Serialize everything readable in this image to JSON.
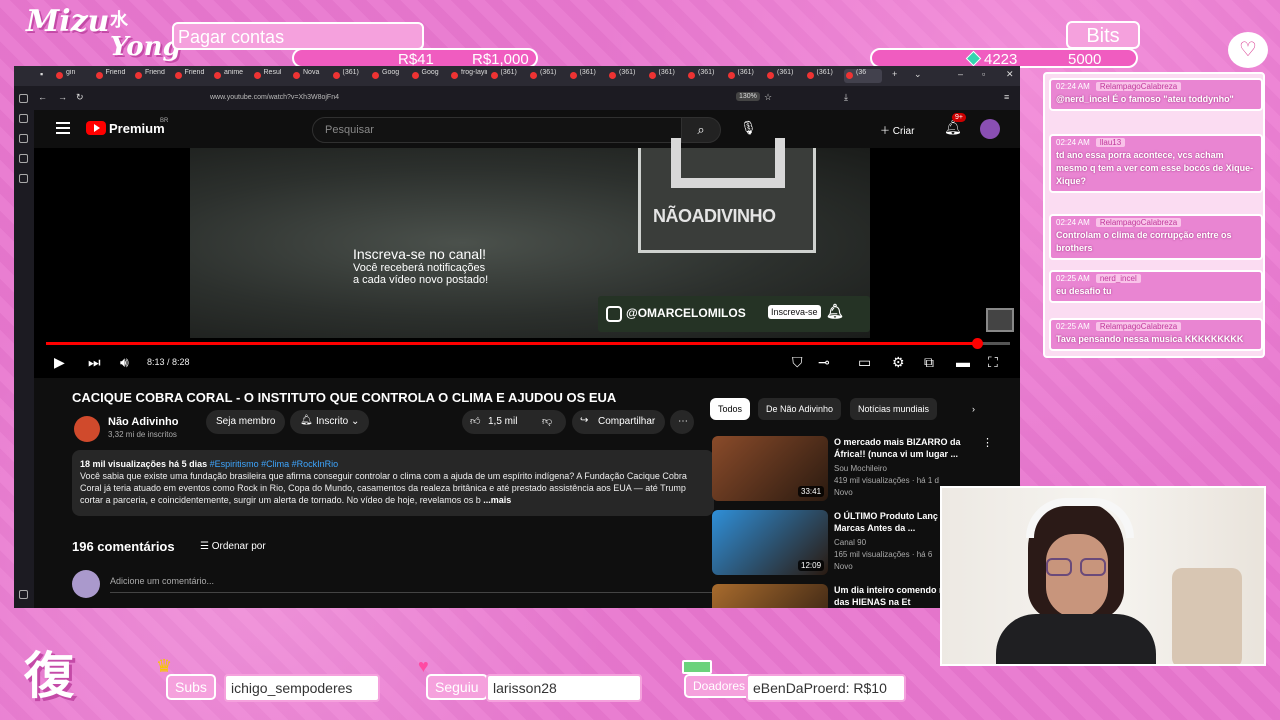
{
  "overlay": {
    "brand_name_1": "Mizu",
    "brand_name_2": "Yong",
    "brand_kanji": "水",
    "goal": {
      "title": "Pagar contas",
      "current": "R$41",
      "target": "R$1,000",
      "progress": 0.041
    },
    "bits": {
      "title": "Bits",
      "current": "4223",
      "target": "5000",
      "progress": 0.8446
    },
    "heart_icon": "chat-heart-icon",
    "bottom_logo": "復",
    "subs": {
      "label": "Subs",
      "value": "ichigo_sempoderes"
    },
    "follow": {
      "label": "Seguiu",
      "value": "larisson28"
    },
    "donors": {
      "label": "Doadores",
      "value": "eBenDaProerd: R$10"
    }
  },
  "browser": {
    "url": "www.youtube.com/watch?v=Xh3W8ojFn4",
    "zoom": "130%",
    "tabs": [
      "gin",
      "Friend",
      "Friend",
      "Friend",
      "anime",
      "Resul",
      "Nova",
      "(361)",
      "Goog",
      "Goog",
      "frog-layin",
      "(361)",
      "(361)",
      "(361)",
      "(361)",
      "(361)",
      "(361)",
      "(361)",
      "(361)",
      "(361)",
      "(36"
    ]
  },
  "youtube": {
    "brand": "Premium",
    "brand_region": "BR",
    "search_placeholder": "Pesquisar",
    "create_label": "Criar",
    "notif_count": "9+",
    "video": {
      "channel_card_name": "NÃOADIVINHO",
      "subscribe_title": "Inscreva-se no canal!",
      "subscribe_line1": "Você receberá notificações",
      "subscribe_line2": "a cada vídeo novo postado!",
      "handle": "@OMARCELOMILOS",
      "handle_subscribe": "Inscreva-se",
      "time": "8:13 / 8:28",
      "progress": 0.9657
    },
    "title": "CACIQUE COBRA CORAL - O INSTITUTO QUE CONTROLA O CLIMA E AJUDOU OS EUA",
    "channel": {
      "name": "Não Adivinho",
      "subs": "3,32 mi de inscritos"
    },
    "buttons": {
      "member": "Seja membro",
      "subscribed": "Inscrito",
      "likes": "1,5 mil",
      "share": "Compartilhar"
    },
    "description": {
      "views": "18 mil visualizações",
      "date": "há 5 dias",
      "tags": "#Espiritismo #Clima #RockInRio",
      "text": "Você sabia que existe uma fundação brasileira que afirma conseguir controlar o clima com a ajuda de um espírito indígena? A Fundação Cacique Cobra Coral já teria atuado em eventos como Rock in Rio, Copa do Mundo, casamentos da realeza britânica e até prestado assistência aos EUA — até Trump cortar a parceria, e coincidentemente, surgir um alerta de tornado. No vídeo de hoje, revelamos os b",
      "more": "...mais"
    },
    "comments": {
      "count": "196 comentários",
      "order": "Ordenar por",
      "add_placeholder": "Adicione um comentário..."
    },
    "chips": [
      "Todos",
      "De Não Adivinho",
      "Notícias mundiais"
    ],
    "recommendations": [
      {
        "title": "O mercado mais BIZARRO da África!! (nunca vi um lugar ...",
        "channel": "Sou Mochileiro",
        "views": "419 mil visualizações · há 1 d",
        "badge": "Novo",
        "duration": "33:41",
        "color": "#8a4b2a"
      },
      {
        "title": "O ÚLTIMO Produto Lanç pelas Marcas Antes da ...",
        "channel": "Canal 90",
        "views": "165 mil visualizações · há 6",
        "badge": "Novo",
        "duration": "12:09",
        "color": "#2f8fd8"
      },
      {
        "title": "Um dia inteiro comendo n cidade das HIENAS na Et",
        "channel": "",
        "views": "",
        "badge": "",
        "duration": "",
        "color": "#a86b2d"
      }
    ]
  },
  "chat": [
    {
      "time": "02:24 AM",
      "user": "RelampagoCalabreza",
      "text": "@nerd_incel É o famoso \"ateu toddynho\""
    },
    {
      "time": "02:24 AM",
      "user": "llau13",
      "text": "td ano essa porra acontece, vcs acham mesmo q tem a ver com esse bocós de Xique-Xique?"
    },
    {
      "time": "02:24 AM",
      "user": "RelampagoCalabreza",
      "text": "Controlam o clima de corrupção entre os brothers"
    },
    {
      "time": "02:25 AM",
      "user": "nerd_incel",
      "text": "eu desafio tu"
    },
    {
      "time": "02:25 AM",
      "user": "RelampagoCalabreza",
      "text": "Tava pensando nessa musica KKKKKKKKK"
    }
  ]
}
